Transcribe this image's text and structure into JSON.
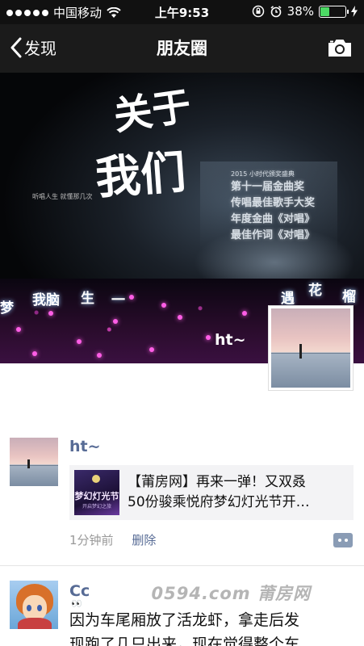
{
  "status_bar": {
    "carrier": "中国移动",
    "time": "上午9:53",
    "battery_percent": "38%",
    "battery_level": 0.38,
    "icons": [
      "signal-dots-icon",
      "wifi-icon",
      "lock-rotation-icon",
      "alarm-icon",
      "battery-icon",
      "charging-icon"
    ]
  },
  "nav": {
    "back_label": "发现",
    "title": "朋友圈",
    "camera_icon": "camera-icon"
  },
  "cover": {
    "calligraphy_line1": "关于",
    "calligraphy_line2": "我们",
    "small_hint": "听唱人生 就懂那几次",
    "screen_lines": [
      "第十一届金曲奖",
      "传唱最佳歌手大奖",
      "年度金曲《对唱》",
      "最佳作词《对唱》"
    ],
    "screen_small": "2015 小时代颁奖盛典",
    "lyrics": [
      "梦",
      "我脑",
      "生",
      "一",
      "遇",
      "花",
      "榴"
    ],
    "owner_name": "ht~"
  },
  "posts": [
    {
      "name": "ht~",
      "share": {
        "title_line1": "【莆房网】再来一弹！又双叒",
        "title_line2": "50份骏乘悦府梦幻灯光节开…",
        "thumb_text": "梦幻灯光节",
        "thumb_sub": "开启梦幻之旅"
      },
      "time": "1分钟前",
      "delete_label": "删除"
    },
    {
      "name": "Cc",
      "emoji": "👀",
      "text_line1": "因为车尾厢放了活龙虾，拿走后发",
      "text_line2": "现跑了几只出来，现在觉得整个车"
    }
  ],
  "watermark": "0594.com 莆房网",
  "colors": {
    "link_blue": "#576b95",
    "nav_bg": "#1b1b1b",
    "battery_green": "#4cd964"
  }
}
